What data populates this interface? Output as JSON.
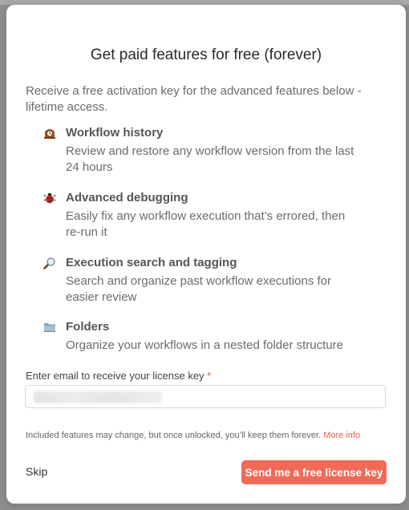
{
  "modal": {
    "title": "Get paid features for free (forever)",
    "intro": "Receive a free activation key for the advanced features below - lifetime access."
  },
  "features": [
    {
      "icon": "mantel-clock-icon",
      "title": "Workflow history",
      "description": "Review and restore any workflow version from the last 24 hours"
    },
    {
      "icon": "ladybug-icon",
      "title": "Advanced debugging",
      "description": "Easily fix any workflow execution that’s errored, then re-run it"
    },
    {
      "icon": "magnifying-glass-icon",
      "title": "Execution search and tagging",
      "description": "Search and organize past workflow executions for easier review"
    },
    {
      "icon": "folder-icon",
      "title": "Folders",
      "description": "Organize your workflows in a nested folder structure"
    }
  ],
  "email": {
    "label": "Enter email to receive your license key",
    "required_marker": "*"
  },
  "disclaimer": {
    "text": "Included features may change, but once unlocked, you’ll keep them forever.",
    "link": "More info"
  },
  "actions": {
    "skip": "Skip",
    "submit": "Send me a free license key"
  },
  "colors": {
    "accent": "#ef6b58",
    "link": "#e8644e",
    "required": "#e3563f"
  }
}
